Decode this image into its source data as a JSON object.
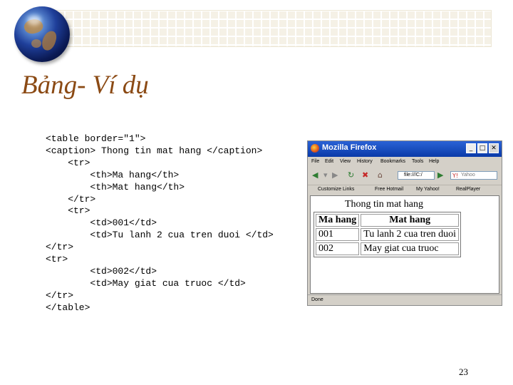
{
  "slide": {
    "title": "Bảng- Ví dụ",
    "page_number": "23",
    "code_lines": [
      "<table border=\"1\">",
      "<caption> Thong tin mat hang </caption>",
      "    <tr>",
      "        <th>Ma hang</th>",
      "        <th>Mat hang</th>",
      "    </tr>",
      "    <tr>",
      "        <td>001</td>",
      "        <td>Tu lanh 2 cua tren duoi </td>",
      "</tr>",
      "<tr>",
      "        <td>002</td>",
      "        <td>May giat cua truoc </td>",
      "</tr>",
      "</table>"
    ]
  },
  "browser": {
    "window_title": "Mozilla Firefox",
    "title_buttons": {
      "minimize": "_",
      "maximize": "□",
      "close": "✕"
    },
    "menu": [
      "File",
      "Edit",
      "View",
      "History",
      "Bookmarks",
      "Tools",
      "Help"
    ],
    "address": "file:///C:/",
    "search_placeholder": "Yahoo",
    "bookmarks": [
      "Customize Links",
      "Free Hotmail",
      "My Yahoo!",
      "RealPlayer"
    ],
    "status": "Done",
    "page": {
      "caption": "Thong tin mat hang",
      "headers": [
        "Ma hang",
        "Mat hang"
      ],
      "rows": [
        [
          "001",
          "Tu lanh 2 cua tren duoi"
        ],
        [
          "002",
          "May giat cua truoc"
        ]
      ]
    }
  },
  "icons": {
    "globe": "globe-icon",
    "back": "back-arrow-icon",
    "forward": "forward-arrow-icon",
    "reload": "reload-icon",
    "stop": "stop-icon",
    "home": "home-icon",
    "go": "go-arrow-icon",
    "search_engine": "yahoo-icon",
    "search": "search-icon"
  },
  "colors": {
    "title": "#8b4a14",
    "titlebar": "#0a3aa8",
    "band": "#f5f1e6"
  }
}
